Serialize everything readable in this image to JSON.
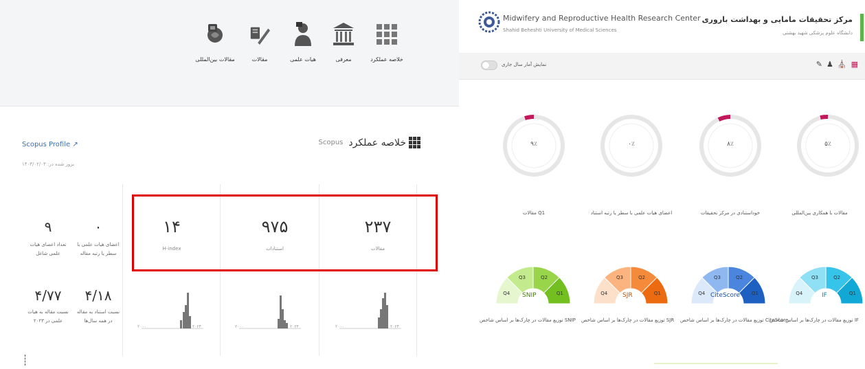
{
  "nav": {
    "items": [
      {
        "label": "مقالات بین‌المللی",
        "icon": "globe-badge-icon"
      },
      {
        "label": "مقالات",
        "icon": "pen-document-icon"
      },
      {
        "label": "هیات علمی",
        "icon": "person-icon"
      },
      {
        "label": "معرفی",
        "icon": "building-icon"
      },
      {
        "label": "خلاصه عملکرد",
        "icon": "grid-icon"
      }
    ]
  },
  "summary": {
    "title": "خلاصه عملکرد",
    "source": "Scopus",
    "scopus_link": "Scopus Profile",
    "updated": "بروز شده در: ۱۴۰۳/۰۲/۰۳",
    "stats": [
      {
        "value": "۲۳۷",
        "label": "مقالات"
      },
      {
        "value": "۹۷۵",
        "label": "استنادات"
      },
      {
        "value": "۱۴",
        "label": "H-index"
      }
    ],
    "side_stats": [
      {
        "value": "۹",
        "label": "تعداد اعضای هیات علمی شاغل"
      },
      {
        "value": "۰",
        "label": "اعضای هیات علمی با سطر یا رتبه مقاله"
      },
      {
        "value": "۴/۷۷",
        "label": "نسبت مقاله به هیات علمی در ۲۰۲۳"
      },
      {
        "value": "۴/۱۸",
        "label": "نسبت استناد به مقاله در همه سال‌ها"
      }
    ],
    "chart_labels": {
      "left": "۲۰۰۰",
      "right": "۲۰۲۴"
    }
  },
  "right_header": {
    "title_fa": "مرکز تحقیقات مامایی و بهداشت باروری",
    "subtitle_fa": "دانشگاه علوم پزشکی شهید بهشتی",
    "title_en": "Midwifery and Reproductive Health Research Center",
    "subtitle_en": "Shahid Beheshti University of Medical Sciences",
    "toggle_label": "نمایش آمار سال جاری",
    "accent": "#5bb548"
  },
  "circles": [
    {
      "value": "۵٪",
      "label": "مقالات با همکاری بین‌المللی"
    },
    {
      "value": "۸٪",
      "label": "خوداستنادی در مرکز تحقیقات"
    },
    {
      "value": "۰٪",
      "label": "اعضای هیات علمی با سطر یا رتبه استناد"
    },
    {
      "value": "۹٪",
      "label": "مقالات Q1"
    }
  ],
  "gauges": [
    {
      "name": "IF",
      "label": "توزیع مقالات در چارک‌ها بر اساس شاخص IF",
      "colors": [
        "#d9f3fb",
        "#8fe0f5",
        "#37c4ea",
        "#11a8d6"
      ]
    },
    {
      "name": "CiteScore",
      "label": "توزیع مقالات در چارک‌ها بر اساس شاخص CiteScore",
      "colors": [
        "#dce9fb",
        "#8fb8f0",
        "#4a86dd",
        "#1e5fc2"
      ]
    },
    {
      "name": "SJR",
      "label": "توزیع مقالات در چارک‌ها بر اساس شاخص SJR",
      "colors": [
        "#fde0c9",
        "#fbb47f",
        "#f68a3b",
        "#ec6b10"
      ]
    },
    {
      "name": "SNIP",
      "label": "توزیع مقالات در چارک‌ها بر اساس شاخص SNIP",
      "colors": [
        "#e6f6cf",
        "#c3ea8c",
        "#98d54a",
        "#74bf20"
      ]
    }
  ]
}
